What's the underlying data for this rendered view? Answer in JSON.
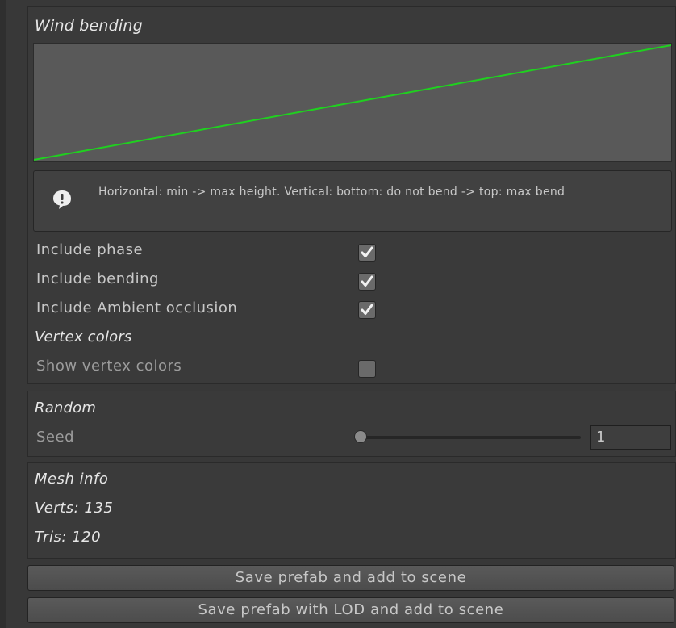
{
  "wind_bending": {
    "title": "Wind bending",
    "curve": {
      "start": [
        0,
        0
      ],
      "end": [
        1,
        1
      ],
      "color": "#1fd11f"
    },
    "help_text": "Horizontal: min -> max height. Vertical: bottom: do not bend -> top: max bend",
    "include_phase": {
      "label": "Include phase",
      "checked": true
    },
    "include_bending": {
      "label": "Include bending",
      "checked": true
    },
    "include_ao": {
      "label": "Include Ambient occlusion",
      "checked": true
    },
    "vertex_colors_heading": "Vertex colors",
    "show_vertex_colors": {
      "label": "Show vertex colors",
      "checked": false
    }
  },
  "random": {
    "title": "Random",
    "seed_label": "Seed",
    "seed_value": "1"
  },
  "mesh_info": {
    "title": "Mesh info",
    "verts": "Verts: 135",
    "tris": "Tris: 120"
  },
  "buttons": {
    "save_prefab": "Save prefab and add to scene",
    "save_prefab_lod": "Save prefab with LOD and add to scene"
  },
  "icons": {
    "help": "warning-icon",
    "check": "checkmark-icon"
  }
}
